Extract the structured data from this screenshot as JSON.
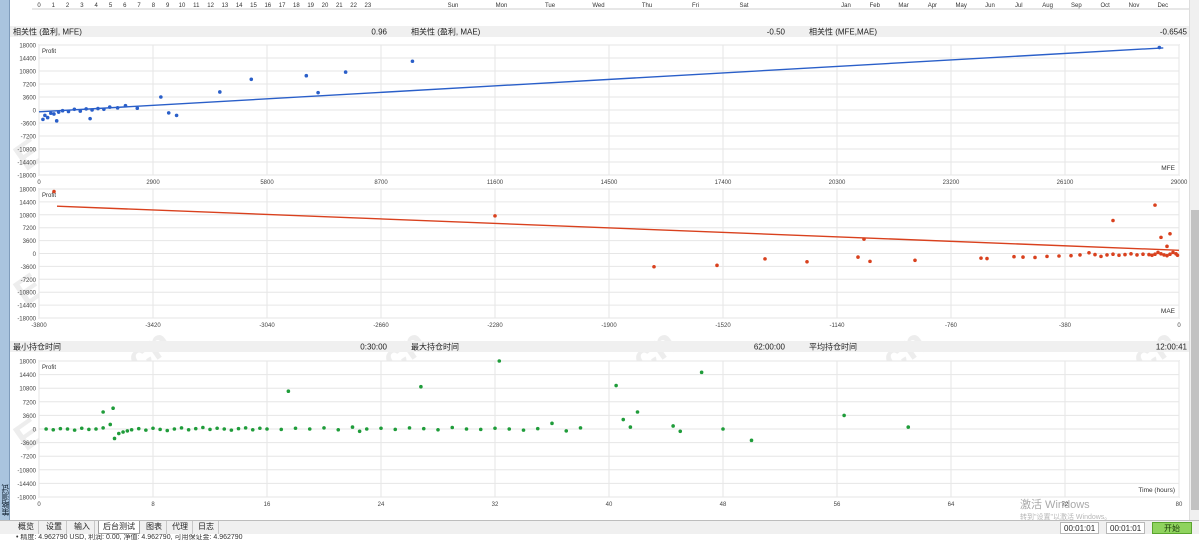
{
  "app": {
    "side_tab_title": "策略测试"
  },
  "top_axes": {
    "hours": [
      "0",
      "1",
      "2",
      "3",
      "4",
      "5",
      "6",
      "7",
      "8",
      "9",
      "10",
      "11",
      "12",
      "13",
      "14",
      "15",
      "16",
      "17",
      "18",
      "19",
      "20",
      "21",
      "22",
      "23"
    ],
    "weekdays": [
      "Sun",
      "Mon",
      "Tue",
      "Wed",
      "Thu",
      "Fri",
      "Sat"
    ],
    "months": [
      "Jan",
      "Feb",
      "Mar",
      "Apr",
      "May",
      "Jun",
      "Jul",
      "Aug",
      "Sep",
      "Oct",
      "Nov",
      "Dec"
    ]
  },
  "correlation_row": {
    "items": [
      {
        "label": "相关性 (盈利, MFE)",
        "value": "0.96"
      },
      {
        "label": "相关性 (盈利, MAE)",
        "value": "-0.50"
      },
      {
        "label": "相关性 (MFE,MAE)",
        "value": "-0.6545"
      }
    ]
  },
  "holding_row": {
    "items": [
      {
        "label": "最小持仓时间",
        "value": "0:30:00"
      },
      {
        "label": "最大持仓时间",
        "value": "62:00:00"
      },
      {
        "label": "平均持仓时间",
        "value": "12:00:41"
      }
    ]
  },
  "watermark": {
    "text": "EAHub.cn"
  },
  "os_overlay": {
    "line1": "激活 Windows",
    "line2": "转到\"设置\"以激活 Windows。"
  },
  "chart_data": [
    {
      "type": "scatter",
      "title": "",
      "ylabel": "Profit",
      "xlabel": "MFE",
      "xlim": [
        0,
        29000
      ],
      "ylim": [
        -18000,
        18000
      ],
      "xticks": [
        0,
        2900,
        5800,
        8700,
        11600,
        14500,
        17400,
        20300,
        23200,
        26100,
        29000
      ],
      "yticks": [
        18000,
        14400,
        10800,
        7200,
        3600,
        0,
        -3600,
        -7200,
        -10800,
        -14400,
        -18000
      ],
      "color": "#2a5fc9",
      "trend": [
        [
          0,
          -500
        ],
        [
          28600,
          17200
        ]
      ],
      "points": [
        [
          100,
          -2600
        ],
        [
          150,
          -1500
        ],
        [
          220,
          -2100
        ],
        [
          300,
          -900
        ],
        [
          380,
          -1100
        ],
        [
          500,
          -600
        ],
        [
          600,
          -200
        ],
        [
          750,
          -400
        ],
        [
          900,
          200
        ],
        [
          1050,
          -300
        ],
        [
          1200,
          300
        ],
        [
          1350,
          0
        ],
        [
          1500,
          400
        ],
        [
          1650,
          200
        ],
        [
          1800,
          800
        ],
        [
          2000,
          600
        ],
        [
          2200,
          1200
        ],
        [
          450,
          -3000
        ],
        [
          3100,
          3600
        ],
        [
          3500,
          -1500
        ],
        [
          4600,
          5000
        ],
        [
          5400,
          8500
        ],
        [
          6800,
          9500
        ],
        [
          7100,
          4800
        ],
        [
          7800,
          10500
        ],
        [
          9500,
          13500
        ],
        [
          28500,
          17300
        ],
        [
          1300,
          -2400
        ],
        [
          2500,
          500
        ],
        [
          3300,
          -800
        ]
      ]
    },
    {
      "type": "scatter",
      "title": "",
      "ylabel": "Profit",
      "xlabel": "MAE",
      "xlim": [
        -3800,
        0
      ],
      "ylim": [
        -18000,
        18000
      ],
      "xticks": [
        -3800,
        -3420,
        -3040,
        -2660,
        -2280,
        -1900,
        -1520,
        -1140,
        -760,
        -380,
        0
      ],
      "yticks": [
        18000,
        14400,
        10800,
        7200,
        3600,
        0,
        -3600,
        -7200,
        -10800,
        -14400,
        -18000
      ],
      "color": "#d9411e",
      "trend": [
        [
          -3740,
          13200
        ],
        [
          0,
          900
        ]
      ],
      "points": [
        [
          -3750,
          17300
        ],
        [
          -2280,
          10500
        ],
        [
          -1750,
          -3700
        ],
        [
          -1540,
          -3300
        ],
        [
          -1380,
          -1500
        ],
        [
          -1240,
          -2300
        ],
        [
          -1070,
          -1000
        ],
        [
          -1050,
          4000
        ],
        [
          -1030,
          -2200
        ],
        [
          -880,
          -1900
        ],
        [
          -660,
          -1300
        ],
        [
          -640,
          -1400
        ],
        [
          -550,
          -900
        ],
        [
          -520,
          -1000
        ],
        [
          -480,
          -1100
        ],
        [
          -440,
          -800
        ],
        [
          -400,
          -700
        ],
        [
          -360,
          -600
        ],
        [
          -330,
          -400
        ],
        [
          -300,
          200
        ],
        [
          -280,
          -300
        ],
        [
          -260,
          -800
        ],
        [
          -240,
          -400
        ],
        [
          -220,
          -200
        ],
        [
          -200,
          -500
        ],
        [
          -180,
          -300
        ],
        [
          -160,
          -100
        ],
        [
          -140,
          -400
        ],
        [
          -120,
          -200
        ],
        [
          -100,
          -300
        ],
        [
          -90,
          -500
        ],
        [
          -80,
          -200
        ],
        [
          -70,
          300
        ],
        [
          -60,
          -100
        ],
        [
          -50,
          -400
        ],
        [
          -40,
          -600
        ],
        [
          -30,
          -200
        ],
        [
          -20,
          300
        ],
        [
          -10,
          -100
        ],
        [
          -5,
          -500
        ],
        [
          -220,
          9200
        ],
        [
          -80,
          13500
        ],
        [
          -60,
          4500
        ],
        [
          -40,
          2000
        ],
        [
          -30,
          5500
        ]
      ]
    },
    {
      "type": "scatter",
      "title": "",
      "ylabel": "Profit",
      "xlabel": "Time (hours)",
      "xlim": [
        0,
        80
      ],
      "ylim": [
        -18000,
        18000
      ],
      "xticks": [
        0,
        8,
        16,
        24,
        32,
        40,
        48,
        56,
        64,
        72,
        80
      ],
      "yticks": [
        18000,
        14400,
        10800,
        7200,
        3600,
        0,
        -3600,
        -7200,
        -10800,
        -14400,
        -18000
      ],
      "color": "#1f9c3a",
      "points": [
        [
          0.5,
          0
        ],
        [
          1,
          -200
        ],
        [
          1.5,
          100
        ],
        [
          2,
          0
        ],
        [
          2.5,
          -300
        ],
        [
          3,
          200
        ],
        [
          3.5,
          -100
        ],
        [
          4,
          0
        ],
        [
          4.5,
          300
        ],
        [
          5,
          1200
        ],
        [
          5.3,
          -2500
        ],
        [
          5.6,
          -1200
        ],
        [
          5.9,
          -800
        ],
        [
          6.2,
          -500
        ],
        [
          6.5,
          -200
        ],
        [
          7,
          100
        ],
        [
          7.5,
          -300
        ],
        [
          8,
          200
        ],
        [
          8.5,
          -100
        ],
        [
          9,
          -400
        ],
        [
          9.5,
          0
        ],
        [
          10,
          300
        ],
        [
          10.5,
          -200
        ],
        [
          11,
          100
        ],
        [
          11.5,
          400
        ],
        [
          12,
          -100
        ],
        [
          12.5,
          200
        ],
        [
          13,
          0
        ],
        [
          13.5,
          -300
        ],
        [
          14,
          100
        ],
        [
          14.5,
          300
        ],
        [
          15,
          -200
        ],
        [
          15.5,
          200
        ],
        [
          16,
          0
        ],
        [
          17,
          -100
        ],
        [
          18,
          200
        ],
        [
          19,
          0
        ],
        [
          20,
          300
        ],
        [
          21,
          -200
        ],
        [
          22,
          500
        ],
        [
          22.5,
          -600
        ],
        [
          23,
          0
        ],
        [
          24,
          200
        ],
        [
          25,
          -100
        ],
        [
          26,
          300
        ],
        [
          27,
          100
        ],
        [
          28,
          -200
        ],
        [
          29,
          400
        ],
        [
          30,
          0
        ],
        [
          31,
          -100
        ],
        [
          32,
          200
        ],
        [
          33,
          0
        ],
        [
          34,
          -300
        ],
        [
          35,
          100
        ],
        [
          4.5,
          4500
        ],
        [
          5.2,
          5500
        ],
        [
          17.5,
          10000
        ],
        [
          26.8,
          11200
        ],
        [
          32.3,
          18000
        ],
        [
          40.5,
          11500
        ],
        [
          41,
          2500
        ],
        [
          41.5,
          500
        ],
        [
          42,
          4500
        ],
        [
          44.5,
          800
        ],
        [
          45,
          -600
        ],
        [
          46.5,
          15000
        ],
        [
          48,
          0
        ],
        [
          50,
          -3000
        ],
        [
          56.5,
          3600
        ],
        [
          61,
          500
        ],
        [
          36,
          1500
        ],
        [
          37,
          -500
        ],
        [
          38,
          300
        ]
      ]
    }
  ],
  "tabs": [
    {
      "label": "概览"
    },
    {
      "label": "设置"
    },
    {
      "label": "输入"
    },
    {
      "label": "后台测试"
    },
    {
      "label": "图表"
    },
    {
      "label": "代理"
    },
    {
      "label": "日志"
    }
  ],
  "times": {
    "elapsed": "00:01:01",
    "total": "00:01:01"
  },
  "buttons": {
    "start": "开始"
  },
  "status_text": "• 精度: 4.962790 USD, 利润: 0.00, 净值: 4.962790, 可用保证金: 4.962790"
}
